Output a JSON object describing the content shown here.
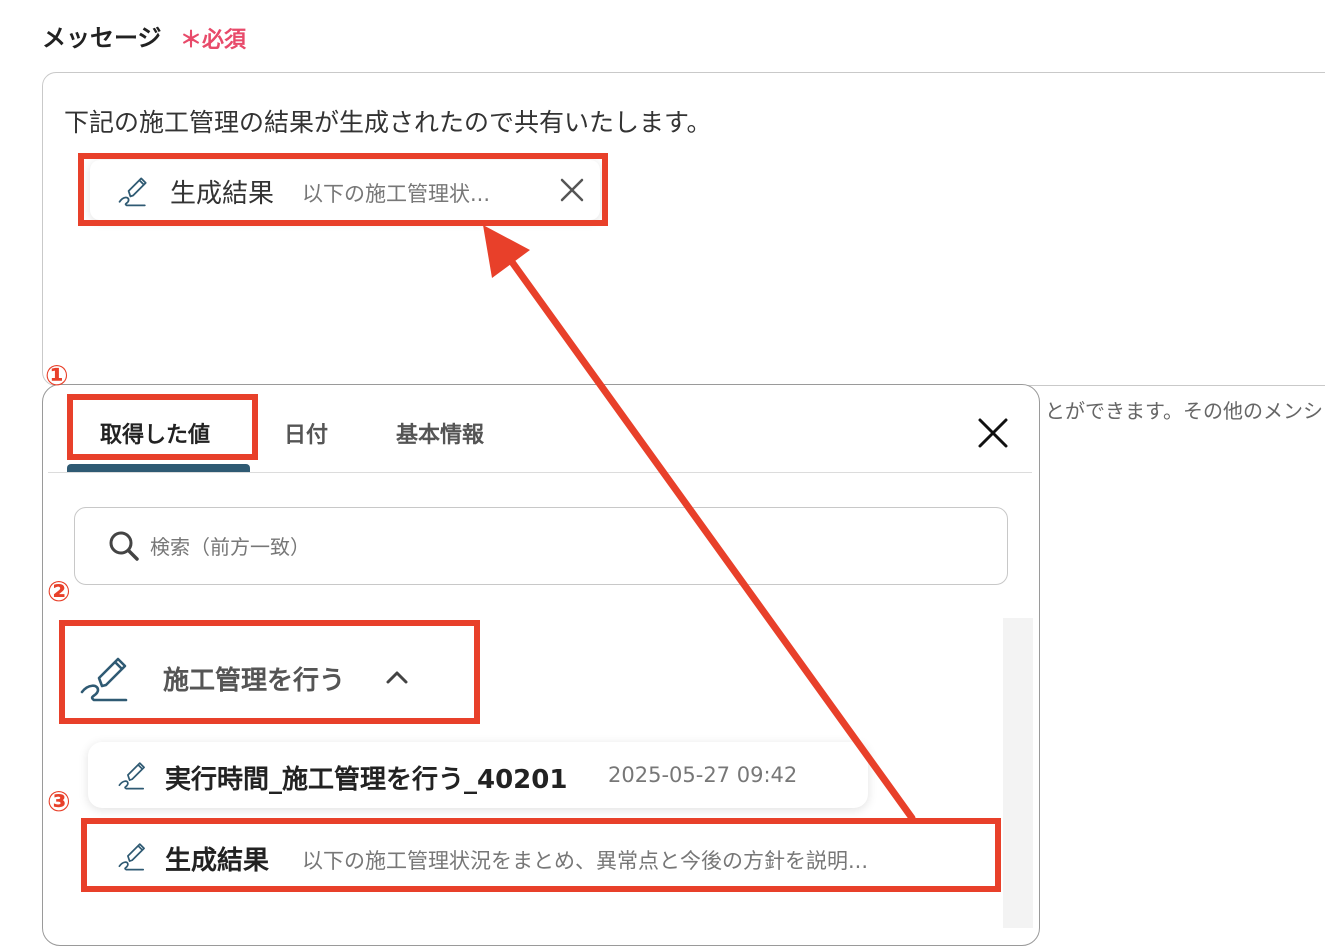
{
  "field": {
    "label": "メッセージ",
    "required_mark": "＊必須"
  },
  "message": {
    "text": "下記の施工管理の結果が生成されたので共有いたします。",
    "chip": {
      "name": "生成結果",
      "preview": "以下の施工管理状..."
    }
  },
  "helper_text": "とができます。その他のメンシ",
  "steps": [
    "①",
    "②",
    "③"
  ],
  "panel": {
    "tabs": [
      {
        "label": "取得した値",
        "active": true
      },
      {
        "label": "日付",
        "active": false
      },
      {
        "label": "基本情報",
        "active": false
      }
    ],
    "search": {
      "placeholder": "検索（前方一致）",
      "value": ""
    },
    "group": {
      "name": "施工管理を行う",
      "expanded": true
    },
    "items": [
      {
        "name": "実行時間_施工管理を行う_40201",
        "value": "2025-05-27 09:42"
      },
      {
        "name": "生成結果",
        "value": "以下の施工管理状況をまとめ、異常点と今後の方針を説明..."
      }
    ]
  },
  "colors": {
    "highlight": "#e8402a",
    "required": "#e84a6a",
    "tab_active": "#2f5a73",
    "icon": "#2f5a73"
  },
  "icons": {
    "chip": "pen-icon",
    "close": "close-icon",
    "search": "search-icon",
    "group": "pen-icon",
    "chevron": "chevron-up-icon"
  }
}
